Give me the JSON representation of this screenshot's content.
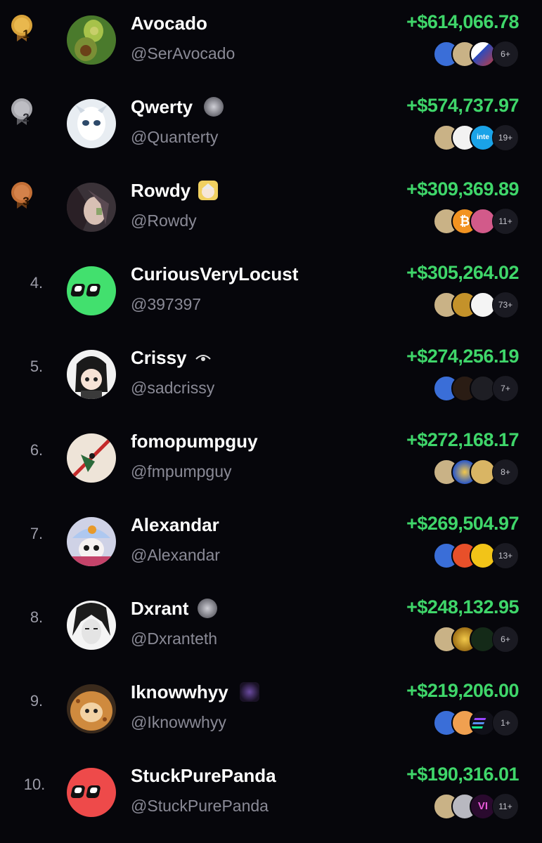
{
  "leaderboard": {
    "rows": [
      {
        "rank": "1",
        "name": "Avocado",
        "handle": "@SerAvocado",
        "pnl": "+$614,066.78",
        "more": "6+",
        "medal": "gold",
        "avatar": "avocado-avatar",
        "badge": null,
        "tokens": [
          "blue",
          "tan",
          "multi"
        ]
      },
      {
        "rank": "2",
        "name": "Qwerty",
        "handle": "@Quanterty",
        "pnl": "+$574,737.97",
        "more": "19+",
        "medal": "silver",
        "avatar": "white-figure-avatar",
        "badge": "gray",
        "tokens": [
          "tan",
          "white",
          "cyan"
        ],
        "token_text": "inte"
      },
      {
        "rank": "3",
        "name": "Rowdy",
        "handle": "@Rowdy",
        "pnl": "+$309,369.89",
        "more": "11+",
        "medal": "bronze",
        "avatar": "anime-avatar",
        "badge": "anime",
        "tokens": [
          "tan",
          "orange",
          "pink"
        ]
      },
      {
        "rank": "4.",
        "name": "CuriousVeryLocust",
        "handle": "@397397",
        "pnl": "+$305,264.02",
        "more": "73+",
        "medal": null,
        "avatar": "green-eyes-avatar",
        "badge": null,
        "tokens": [
          "tan",
          "gold",
          "white"
        ]
      },
      {
        "rank": "5.",
        "name": "Crissy",
        "handle": "@sadcrissy",
        "pnl": "+$274,256.19",
        "more": "7+",
        "medal": null,
        "avatar": "girl-avatar",
        "badge": "eye",
        "tokens": [
          "blue",
          "dark",
          "gray"
        ]
      },
      {
        "rank": "6.",
        "name": "fomopumpguy",
        "handle": "@fmpumpguy",
        "pnl": "+$272,168.17",
        "more": "8+",
        "medal": null,
        "avatar": "bird-avatar",
        "badge": null,
        "tokens": [
          "tan",
          "goldcoin",
          "tan"
        ]
      },
      {
        "rank": "7.",
        "name": "Alexandar",
        "handle": "@Alexandar",
        "pnl": "+$269,504.97",
        "more": "13+",
        "medal": null,
        "avatar": "hat-avatar",
        "badge": null,
        "tokens": [
          "blue",
          "red",
          "yellow"
        ]
      },
      {
        "rank": "8.",
        "name": "Dxrant",
        "handle": "@Dxranteth",
        "pnl": "+$248,132.95",
        "more": "6+",
        "medal": null,
        "avatar": "sketch-avatar",
        "badge": "gray",
        "tokens": [
          "tan",
          "goldcoin",
          "green"
        ]
      },
      {
        "rank": "9.",
        "name": "Iknowwhyy",
        "handle": "@Iknowwhyy",
        "pnl": "+$219,206.00",
        "more": "1+",
        "medal": null,
        "avatar": "cookie-cat-avatar",
        "badge": "purple",
        "tokens": [
          "blue",
          "shiba",
          "sol"
        ]
      },
      {
        "rank": "10.",
        "name": "StuckPurePanda",
        "handle": "@StuckPurePanda",
        "pnl": "+$190,316.01",
        "more": "11+",
        "medal": null,
        "avatar": "red-eyes-avatar",
        "badge": null,
        "tokens": [
          "tan",
          "moon",
          "vi"
        ],
        "token_text3": "VI"
      }
    ]
  },
  "colors": {
    "background": "#06060b",
    "pnl_green": "#3fd66a",
    "handle_gray": "#8a8a96",
    "gold": "#d9a33a",
    "silver": "#a7a7ad",
    "bronze": "#c36f36"
  }
}
